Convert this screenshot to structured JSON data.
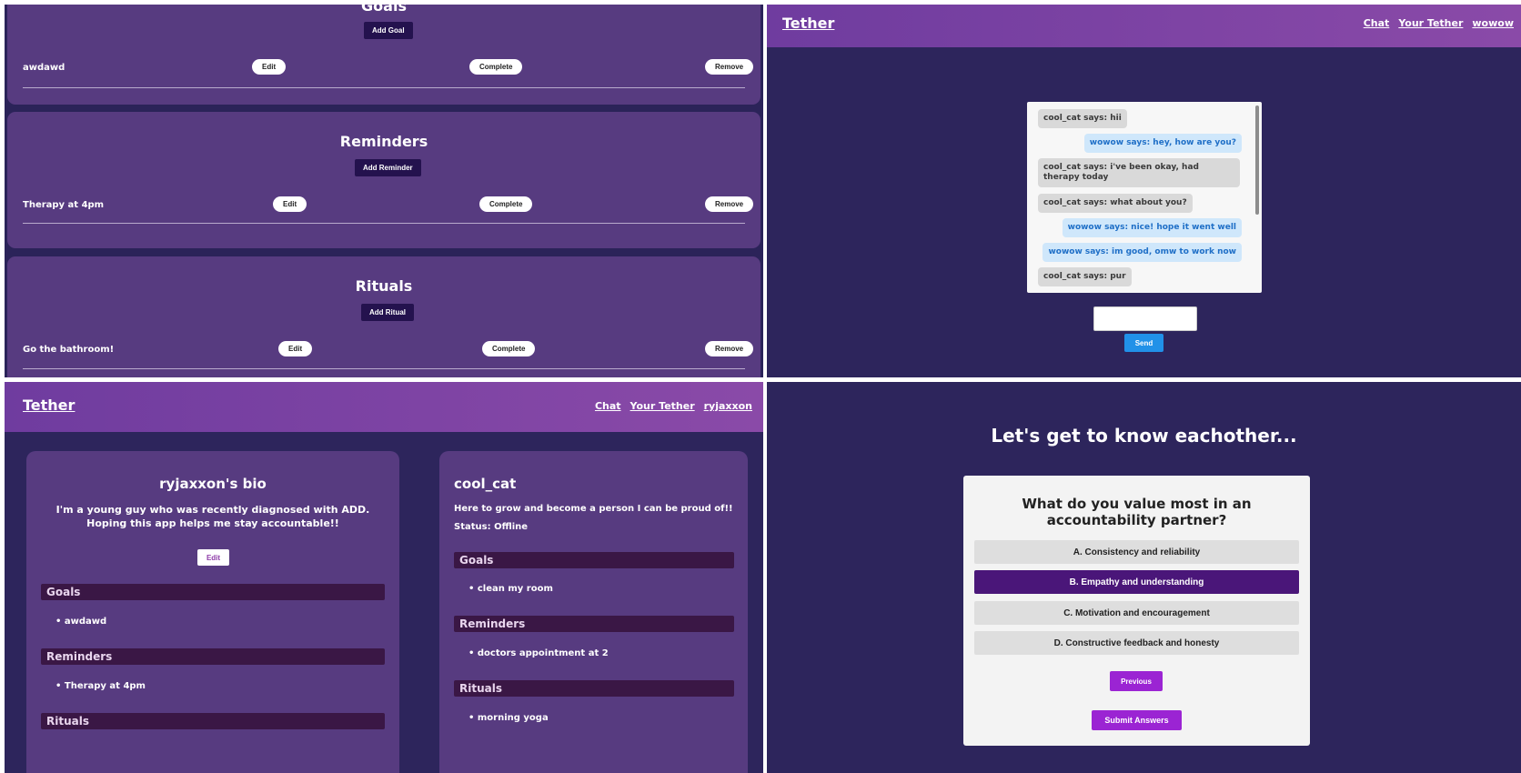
{
  "dashboard": {
    "goals": {
      "title": "Goals",
      "add_label": "Add Goal",
      "item": "awdawd"
    },
    "reminders": {
      "title": "Reminders",
      "add_label": "Add Reminder",
      "item": "Therapy at 4pm"
    },
    "rituals": {
      "title": "Rituals",
      "add_label": "Add Ritual",
      "item": "Go the bathroom!"
    },
    "edit_label": "Edit",
    "complete_label": "Complete",
    "remove_label": "Remove"
  },
  "chat_screen": {
    "brand": "Tether",
    "nav": [
      "Chat",
      "Your Tether",
      "wowow"
    ],
    "messages": [
      {
        "from": "them",
        "text": "cool_cat says: hii"
      },
      {
        "from": "me",
        "text": "wowow says: hey, how are you?"
      },
      {
        "from": "them",
        "text": "cool_cat says: i've been okay, had therapy today"
      },
      {
        "from": "them",
        "text": "cool_cat says: what about you?"
      },
      {
        "from": "me",
        "text": "wowow says: nice! hope it went well"
      },
      {
        "from": "me",
        "text": "wowow says: im good, omw to work now"
      },
      {
        "from": "them",
        "text": "cool_cat says: pur"
      }
    ],
    "send_label": "Send"
  },
  "profile_screen": {
    "brand": "Tether",
    "nav": [
      "Chat",
      "Your Tether",
      "ryjaxxon"
    ],
    "me": {
      "title": "ryjaxxon's bio",
      "bio": "I'm a young guy who was recently diagnosed with ADD. Hoping this app helps me stay accountable!!",
      "edit_label": "Edit",
      "goals_label": "Goals",
      "goals": [
        "awdawd"
      ],
      "reminders_label": "Reminders",
      "reminders": [
        "Therapy at 4pm"
      ],
      "rituals_label": "Rituals"
    },
    "partner": {
      "name": "cool_cat",
      "bio": "Here to grow and become a person I can be proud of!!",
      "status": "Status: Offline",
      "goals_label": "Goals",
      "goals": [
        "clean my room"
      ],
      "reminders_label": "Reminders",
      "reminders": [
        "doctors appointment at 2"
      ],
      "rituals_label": "Rituals",
      "rituals": [
        "morning yoga"
      ]
    }
  },
  "quiz_screen": {
    "title": "Let's get to know eachother...",
    "question": "What do you value most in an accountability partner?",
    "options": [
      "A. Consistency and reliability",
      "B. Empathy and understanding",
      "C. Motivation and encouragement",
      "D. Constructive feedback and honesty"
    ],
    "selected_option": "B. Empathy and understanding",
    "previous_label": "Previous",
    "submit_label": "Submit Answers"
  }
}
